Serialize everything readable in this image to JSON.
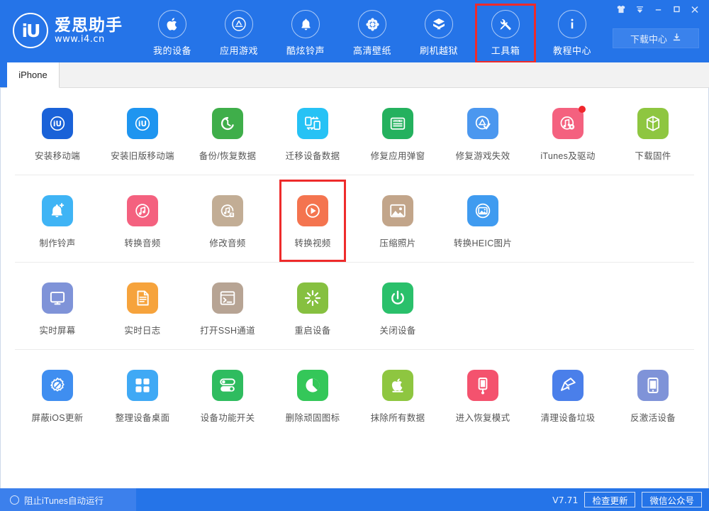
{
  "app": {
    "brand_name": "爱思助手",
    "brand_url": "www.i4.cn",
    "brand_mark": "iU",
    "accent_blue": "#2574e8",
    "highlight_red": "#ee2b2b"
  },
  "header": {
    "nav": [
      {
        "label": "我的设备",
        "icon": "apple-icon",
        "highlighted": false
      },
      {
        "label": "应用游戏",
        "icon": "appstore-icon",
        "highlighted": false
      },
      {
        "label": "酷炫铃声",
        "icon": "bell-icon",
        "highlighted": false
      },
      {
        "label": "高清壁纸",
        "icon": "flower-wallpaper-icon",
        "highlighted": false
      },
      {
        "label": "刷机越狱",
        "icon": "box-download-icon",
        "highlighted": false
      },
      {
        "label": "工具箱",
        "icon": "tools-icon",
        "highlighted": true
      },
      {
        "label": "教程中心",
        "icon": "info-icon",
        "highlighted": false
      }
    ],
    "window_controls": [
      {
        "name": "skin-icon",
        "glyph": "skin"
      },
      {
        "name": "menu-dropdown-icon",
        "glyph": "menu"
      },
      {
        "name": "minimize-icon",
        "glyph": "minimize"
      },
      {
        "name": "maximize-icon",
        "glyph": "maximize"
      },
      {
        "name": "close-icon",
        "glyph": "close"
      }
    ],
    "download_center": {
      "label": "下载中心",
      "icon": "download-icon"
    }
  },
  "tabs": [
    {
      "label": "iPhone",
      "active": true
    }
  ],
  "toolbox": {
    "rows": [
      {
        "cells": [
          {
            "label": "安装移动端",
            "icon": "i4-app-icon",
            "color": "#1a62d8",
            "badge": false
          },
          {
            "label": "安装旧版移动端",
            "icon": "i4-app-old-icon",
            "color": "#1e95f0",
            "badge": false
          },
          {
            "label": "备份/恢复数据",
            "icon": "backup-restore-icon",
            "color": "#3fae4a",
            "badge": false
          },
          {
            "label": "迁移设备数据",
            "icon": "migrate-data-icon",
            "color": "#26c2f5",
            "badge": false
          },
          {
            "label": "修复应用弹窗",
            "icon": "apple-id-card-icon",
            "color": "#24b15e",
            "badge": false
          },
          {
            "label": "修复游戏失效",
            "icon": "appstore-check-icon",
            "color": "#4b97ef",
            "badge": false
          },
          {
            "label": "iTunes及驱动",
            "icon": "itunes-driver-icon",
            "color": "#f4617f",
            "badge": true
          },
          {
            "label": "下载固件",
            "icon": "firmware-box-icon",
            "color": "#8ec640",
            "badge": false
          }
        ]
      },
      {
        "cells": [
          {
            "label": "制作铃声",
            "icon": "make-ringtone-icon",
            "color": "#3fb4f5",
            "badge": false
          },
          {
            "label": "转换音频",
            "icon": "convert-audio-icon",
            "color": "#f4617f",
            "badge": false
          },
          {
            "label": "修改音频",
            "icon": "edit-audio-icon",
            "color": "#c2ad95",
            "badge": false
          },
          {
            "label": "转换视频",
            "icon": "convert-video-icon",
            "color": "#f4744f",
            "badge": false,
            "highlighted": true
          },
          {
            "label": "压缩照片",
            "icon": "compress-photo-icon",
            "color": "#c2a58a",
            "badge": false
          },
          {
            "label": "转换HEIC图片",
            "icon": "convert-heic-icon",
            "color": "#3f9bf0",
            "badge": false
          },
          {
            "label": "",
            "icon": "",
            "color": "",
            "empty": true
          },
          {
            "label": "",
            "icon": "",
            "color": "",
            "empty": true
          }
        ]
      },
      {
        "cells": [
          {
            "label": "实时屏幕",
            "icon": "live-screen-icon",
            "color": "#7f93d8",
            "badge": false
          },
          {
            "label": "实时日志",
            "icon": "live-log-icon",
            "color": "#f6a33c",
            "badge": false
          },
          {
            "label": "打开SSH通道",
            "icon": "ssh-terminal-icon",
            "color": "#b7a494",
            "badge": false
          },
          {
            "label": "重启设备",
            "icon": "restart-device-icon",
            "color": "#86c040",
            "badge": false
          },
          {
            "label": "关闭设备",
            "icon": "power-off-icon",
            "color": "#2ac06b",
            "badge": false
          },
          {
            "label": "",
            "icon": "",
            "color": "",
            "empty": true
          },
          {
            "label": "",
            "icon": "",
            "color": "",
            "empty": true
          },
          {
            "label": "",
            "icon": "",
            "color": "",
            "empty": true
          }
        ]
      },
      {
        "cells": [
          {
            "label": "屏蔽iOS更新",
            "icon": "block-ios-update-icon",
            "color": "#3f8ef0",
            "badge": false
          },
          {
            "label": "整理设备桌面",
            "icon": "organize-desktop-icon",
            "color": "#3fa9f5",
            "badge": false
          },
          {
            "label": "设备功能开关",
            "icon": "feature-toggle-icon",
            "color": "#2fbc5f",
            "badge": false
          },
          {
            "label": "删除顽固图标",
            "icon": "delete-stubborn-icon",
            "color": "#34c759",
            "badge": false
          },
          {
            "label": "抹除所有数据",
            "icon": "erase-data-icon",
            "color": "#8ec640",
            "badge": false
          },
          {
            "label": "进入恢复模式",
            "icon": "recovery-mode-icon",
            "color": "#f4526e",
            "badge": false
          },
          {
            "label": "清理设备垃圾",
            "icon": "clean-junk-icon",
            "color": "#4a7fea",
            "badge": false
          },
          {
            "label": "反激活设备",
            "icon": "deactivate-device-icon",
            "color": "#7f93d8",
            "badge": false
          }
        ]
      }
    ]
  },
  "statusbar": {
    "block_itunes_label": "阻止iTunes自动运行",
    "version": "V7.71",
    "check_update_label": "检查更新",
    "wechat_label": "微信公众号"
  }
}
